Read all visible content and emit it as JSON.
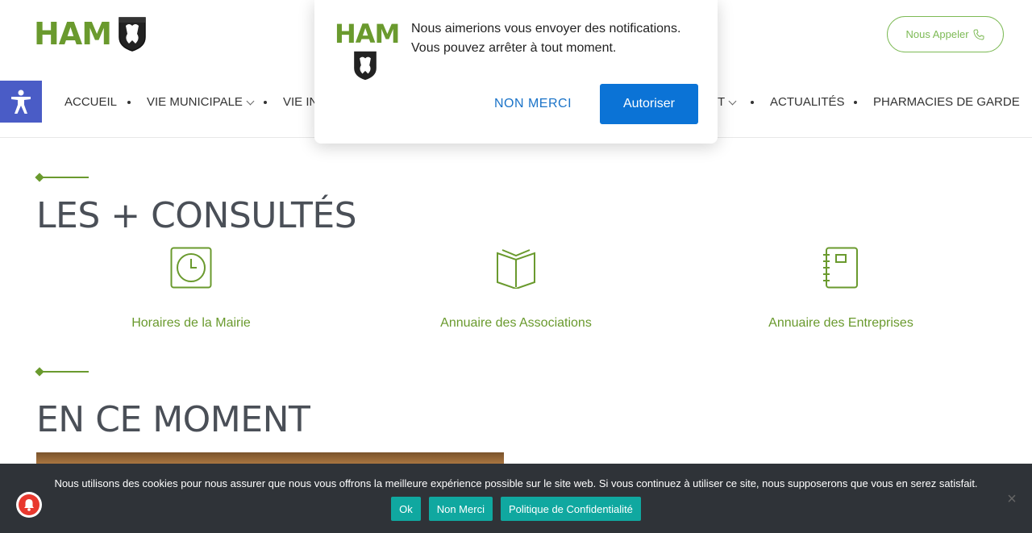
{
  "header": {
    "logo_text": "HAM",
    "call_button": "Nous Appeler",
    "nav": [
      {
        "label": "ACCUEIL",
        "has_dropdown": false
      },
      {
        "label": "VIE MUNICIPALE",
        "has_dropdown": true
      },
      {
        "label": "VIE IN",
        "has_dropdown": false
      },
      {
        "label": "T",
        "has_dropdown": true
      },
      {
        "label": "ACTUALITÉS",
        "has_dropdown": false
      },
      {
        "label": "PHARMACIES DE GARDE",
        "has_dropdown": false
      }
    ]
  },
  "notification": {
    "logo_text": "HAM",
    "message": "Nous aimerions vous envoyer des notifications. Vous pouvez arrêter à tout moment.",
    "decline": "NON MERCI",
    "accept": "Autoriser"
  },
  "sections": {
    "most_viewed": {
      "title": "LES + CONSULTÉS",
      "items": [
        {
          "label": "Horaires de la Mairie",
          "icon": "clock-icon"
        },
        {
          "label": "Annuaire des Associations",
          "icon": "open-book-icon"
        },
        {
          "label": "Annuaire des Entreprises",
          "icon": "notebook-icon"
        }
      ]
    },
    "now": {
      "title": "EN CE MOMENT"
    }
  },
  "cookie_bar": {
    "text": "Nous utilisons des cookies pour nous assurer que nous vous offrons la meilleure expérience possible sur le site web. Si vous continuez à utiliser ce site, nous supposerons que vous en serez satisfait.",
    "ok": "Ok",
    "decline": "Non Merci",
    "policy": "Politique de Confidentialité",
    "close": "×"
  },
  "colors": {
    "brand_green": "#6a9a2e",
    "accent_blue": "#0b73d6",
    "accessibility_blue": "#4a5cc6",
    "cookie_bg": "#2f3338",
    "cookie_button": "#10a8a0",
    "bell_red": "#e8382e"
  }
}
